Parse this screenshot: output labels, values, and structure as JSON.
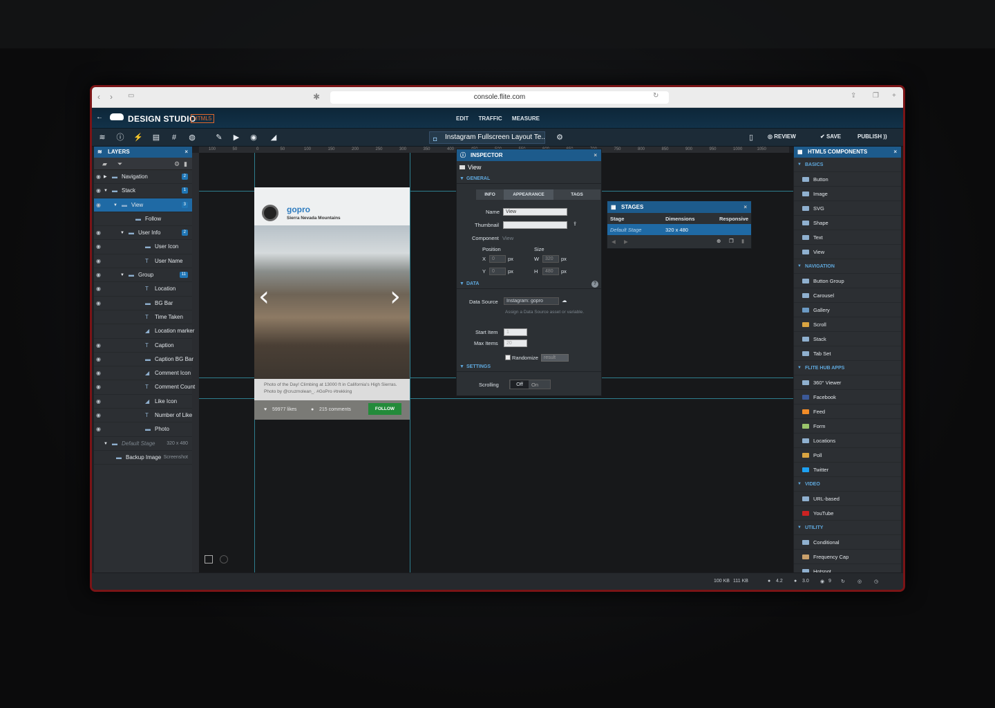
{
  "browser": {
    "url": "console.flite.com"
  },
  "app": {
    "brand": "DESIGN STUDIO",
    "badge": "HTML5",
    "nav": [
      "EDIT",
      "TRAFFIC",
      "MEASURE"
    ]
  },
  "toolbar": {
    "layout_title": "Instagram Fullscreen Layout Te...",
    "review": "REVIEW",
    "save": "SAVE",
    "publish": "PUBLISH"
  },
  "ruler_ticks": [
    "100",
    "50",
    "0",
    "50",
    "100",
    "150",
    "200",
    "250",
    "300",
    "350",
    "400",
    "450",
    "500",
    "550",
    "600",
    "650",
    "700",
    "750",
    "800",
    "850",
    "900",
    "950",
    "1000",
    "1050"
  ],
  "layers": {
    "title": "LAYERS",
    "items": [
      {
        "label": "Navigation",
        "count": "2"
      },
      {
        "label": "Stack",
        "count": "1"
      },
      {
        "label": "View",
        "count": "3"
      },
      {
        "label": "Follow"
      },
      {
        "label": "User Info",
        "count": "2"
      },
      {
        "label": "User Icon"
      },
      {
        "label": "User Name"
      },
      {
        "label": "Group",
        "count": "11"
      },
      {
        "label": "Location"
      },
      {
        "label": "BG Bar"
      },
      {
        "label": "Time Taken"
      },
      {
        "label": "Location marker"
      },
      {
        "label": "Caption"
      },
      {
        "label": "Caption BG Bar"
      },
      {
        "label": "Comment Icon"
      },
      {
        "label": "Comment Count"
      },
      {
        "label": "Like Icon"
      },
      {
        "label": "Number of Like"
      },
      {
        "label": "Photo"
      },
      {
        "label": "Default Stage",
        "sub": "320 x 480"
      },
      {
        "label": "Backup Image",
        "sub": "Screenshot"
      }
    ]
  },
  "preview": {
    "username": "gopro",
    "location": "Sierra Nevada Mountains",
    "caption": "Photo of the Day! Climbing at 13000 ft in California's High Sierras. Photo by @cruzmolean_. #GoPro #trekking",
    "likes": "59977 likes",
    "comments": "215 comments",
    "follow": "FOLLOW"
  },
  "inspector": {
    "title": "INSPECTOR",
    "element": "View",
    "general": "GENERAL",
    "tabs": [
      "INFO",
      "APPEARANCE",
      "TAGS"
    ],
    "name_label": "Name",
    "name_value": "View",
    "thumbnail_label": "Thumbnail",
    "component_label": "Component",
    "component_value": "View",
    "position_label": "Position",
    "size_label": "Size",
    "x_label": "X",
    "x_value": "0",
    "y_label": "Y",
    "y_value": "0",
    "w_label": "W",
    "w_value": "320",
    "h_label": "H",
    "h_value": "480",
    "unit": "px",
    "data": "DATA",
    "datasource_label": "Data Source",
    "datasource_value": "Instagram: gopro",
    "datasource_hint": "Assign a Data Source asset or variable.",
    "start_label": "Start Item",
    "start_value": "1",
    "max_label": "Max Items",
    "max_value": "20",
    "randomize_label": "Randomize",
    "randomize_value": "result",
    "settings": "SETTINGS",
    "scrolling_label": "Scrolling",
    "off": "Off",
    "on": "On"
  },
  "stages": {
    "title": "STAGES",
    "cols": [
      "Stage",
      "Dimensions",
      "Responsive"
    ],
    "row_stage": "Default Stage",
    "row_dims": "320 x 480"
  },
  "components": {
    "title": "HTML5 COMPONENTS",
    "groups": [
      {
        "name": "BASICS",
        "items": [
          "Button",
          "Image",
          "SVG",
          "Shape",
          "Text",
          "View"
        ]
      },
      {
        "name": "NAVIGATION",
        "items": [
          "Button Group",
          "Carousel",
          "Gallery",
          "Scroll",
          "Stack",
          "Tab Set"
        ]
      },
      {
        "name": "FLITE HUB APPS",
        "items": [
          "360° Viewer",
          "Facebook",
          "Feed",
          "Form",
          "Locations",
          "Poll",
          "Twitter"
        ]
      },
      {
        "name": "VIDEO",
        "items": [
          "URL-based",
          "YouTube"
        ]
      },
      {
        "name": "UTILITY",
        "items": [
          "Conditional",
          "Frequency Cap",
          "Hotspot"
        ]
      }
    ]
  },
  "status": {
    "size1": "100 KB",
    "size2": "111 KB",
    "ios": "4.2",
    "android": "3.0",
    "v3": "9"
  }
}
